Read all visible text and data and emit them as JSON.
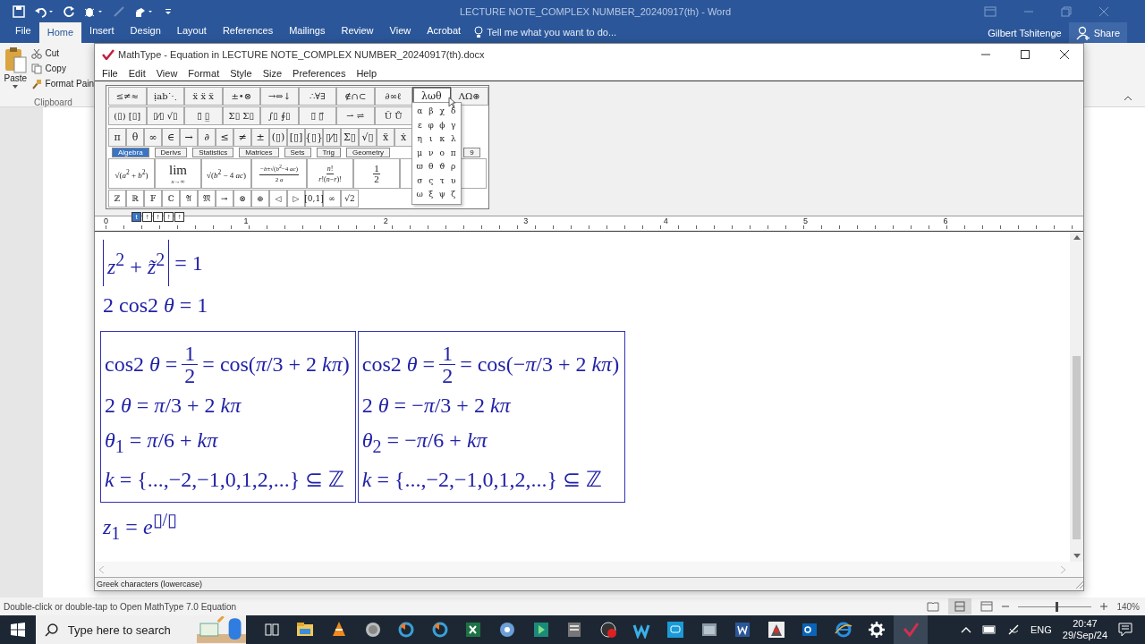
{
  "word": {
    "title": "LECTURE NOTE_COMPLEX NUMBER_20240917(th) - Word",
    "tabs": [
      {
        "label": "File",
        "selected": false
      },
      {
        "label": "Home",
        "selected": true
      },
      {
        "label": "Insert",
        "selected": false
      },
      {
        "label": "Design",
        "selected": false
      },
      {
        "label": "Layout",
        "selected": false
      },
      {
        "label": "References",
        "selected": false
      },
      {
        "label": "Mailings",
        "selected": false
      },
      {
        "label": "Review",
        "selected": false
      },
      {
        "label": "View",
        "selected": false
      },
      {
        "label": "Acrobat",
        "selected": false
      }
    ],
    "tell_me": "Tell me what you want to do...",
    "user": "Gilbert Tshitenge",
    "share": "Share",
    "clipboard": {
      "paste": "Paste",
      "cut": "Cut",
      "copy": "Copy",
      "format_painter": "Format Pain",
      "group_label": "Clipboard"
    },
    "status_bar": {
      "message": "Double-click or double-tap to Open MathType 7.0 Equation",
      "zoom": "140%",
      "zoom_slider": {
        "level": 0.52
      }
    }
  },
  "mathtype": {
    "title": "MathType - Equation in LECTURE NOTE_COMPLEX NUMBER_20240917(th).docx",
    "menu": [
      "File",
      "Edit",
      "View",
      "Format",
      "Style",
      "Size",
      "Preferences",
      "Help"
    ],
    "palette_row_1": [
      {
        "label": "≤≠≈",
        "selected": false
      },
      {
        "label": "ịab⋱",
        "selected": false
      },
      {
        "label": "ẍ ẍ ẍ",
        "selected": false
      },
      {
        "label": "±•⊗",
        "selected": false
      },
      {
        "label": "→⇔↓",
        "selected": false
      },
      {
        "label": "∴∀∃",
        "selected": false
      },
      {
        "label": "∉∩⊂",
        "selected": false
      },
      {
        "label": "∂∞ℓ",
        "selected": false
      },
      {
        "label": "λωθ",
        "selected": true
      },
      {
        "label": "ΛΩ⊛",
        "selected": false
      }
    ],
    "palette_row_2": [
      "(▯) [▯]",
      "▯⁄▯ √▯",
      "▯̈ ▯̲",
      "Σ▯ Σ▯",
      "∫▯ ∮▯",
      "▯̅ ▯⃗",
      "⇀ ⇌",
      "Ū Ů"
    ],
    "symbol_bar": [
      "π",
      "θ",
      "∞",
      "∈",
      "→",
      "∂",
      "≤",
      "≠",
      "±",
      "(▯)",
      "[▯]",
      "{▯}",
      "▯⁄▯",
      "Σ▯",
      "√▯",
      "ẍ",
      "ẋ"
    ],
    "tabs": [
      {
        "label": "Algebra",
        "selected": true
      },
      {
        "label": "Derivs",
        "selected": false
      },
      {
        "label": "Statistics",
        "selected": false
      },
      {
        "label": "Matrices",
        "selected": false
      },
      {
        "label": "Sets",
        "selected": false
      },
      {
        "label": "Trig",
        "selected": false
      },
      {
        "label": "Geometry",
        "selected": false
      },
      {
        "label": "9",
        "selected": false
      }
    ],
    "templates": [
      {
        "text": "√(*a*$^{2}$ + *b*$^{2}$)"
      },
      {
        "text": "lim",
        "sub": "*x*→∞"
      },
      {
        "text": "√(*b*$^{2}$ − 4 *ac*)"
      },
      {
        "num": "−*b*±√(*b*$^{2}$−4 *ac*)",
        "den": "2 *a*"
      },
      {
        "num": "*n*!",
        "den": "*r*!(*n*−*r*)!"
      },
      {
        "num": "1",
        "den": "2"
      }
    ],
    "extra_symbols": [
      "ℤ",
      "ℝ",
      "𝔽",
      "ℂ",
      "𝔄",
      "𝔐",
      "⊸",
      "⊗",
      "⊕",
      "◁",
      "▷",
      "[0,1]",
      "∞",
      "√2"
    ],
    "size_buttons": [
      {
        "label": "t",
        "selected": true
      },
      {
        "label": "↑",
        "selected": false
      },
      {
        "label": "↑",
        "selected": false
      },
      {
        "label": "↑",
        "selected": false
      },
      {
        "label": "↑",
        "selected": false
      }
    ],
    "greek_menu": [
      [
        "α",
        "β",
        "χ",
        "δ"
      ],
      [
        "ε",
        "φ",
        "ϕ",
        "γ"
      ],
      [
        "η",
        "ι",
        "κ",
        "λ"
      ],
      [
        "μ",
        "ν",
        "ο",
        "π"
      ],
      [
        "ϖ",
        "θ",
        "ϑ",
        "ρ"
      ],
      [
        "σ",
        "ς",
        "τ",
        "υ"
      ],
      [
        "ω",
        "ξ",
        "ψ",
        "ζ"
      ]
    ],
    "ruler_labels": [
      "0",
      "1",
      "2",
      "3",
      "4",
      "5",
      "6"
    ],
    "equations": [
      {
        "kind": "line",
        "parts": [
          {
            "kind": "abs",
            "text": "*z*$^{2}$ + *z̃*$^{2}$"
          },
          {
            "kind": "text",
            "text": "= 1"
          }
        ]
      },
      {
        "kind": "line",
        "parts": [
          {
            "kind": "text",
            "text": "2 cos2 *θ* = 1"
          }
        ]
      },
      {
        "kind": "boxes",
        "boxes": [
          {
            "lines": [
              {
                "parts": [
                  {
                    "kind": "text",
                    "text": "cos2 *θ* ="
                  },
                  {
                    "kind": "fraction",
                    "num": "1",
                    "den": "2"
                  },
                  {
                    "kind": "text",
                    "text": "= cos(*π*/3 + 2 *kπ*)"
                  }
                ]
              },
              {
                "parts": [
                  {
                    "kind": "text",
                    "text": "2 *θ* = *π*/3 + 2 *kπ*"
                  }
                ]
              },
              {
                "parts": [
                  {
                    "kind": "text",
                    "text": "*θ*$_{1}$ = *π*/6 + *kπ*"
                  }
                ]
              },
              {
                "parts": [
                  {
                    "kind": "text",
                    "text": "*k* = {...,−2,−1,0,1,2,...} ⊆ ℤ"
                  }
                ]
              }
            ]
          },
          {
            "lines": [
              {
                "parts": [
                  {
                    "kind": "text",
                    "text": "cos2 *θ* ="
                  },
                  {
                    "kind": "fraction",
                    "num": "1",
                    "den": "2"
                  },
                  {
                    "kind": "text",
                    "text": "= cos(−*π*/3 + 2 *kπ*)"
                  }
                ]
              },
              {
                "parts": [
                  {
                    "kind": "text",
                    "text": "2 *θ* = −*π*/3 + 2 *kπ*"
                  }
                ]
              },
              {
                "parts": [
                  {
                    "kind": "text",
                    "text": "*θ*$_{2}$ = −*π*/6 + *kπ*"
                  }
                ]
              },
              {
                "parts": [
                  {
                    "kind": "text",
                    "text": "*k* = {...,−2,−1,0,1,2,...} ⊆ ℤ"
                  }
                ]
              }
            ]
          }
        ]
      },
      {
        "kind": "line",
        "parts": [
          {
            "kind": "text",
            "text": "*z*$_{1}$ = *e*$^{▯/▯}$"
          }
        ]
      }
    ],
    "status": "Greek characters (lowercase)"
  },
  "taskbar": {
    "search_placeholder": "Type here to search",
    "language": "ENG",
    "time": "20:47",
    "date": "29/Sep/24"
  }
}
